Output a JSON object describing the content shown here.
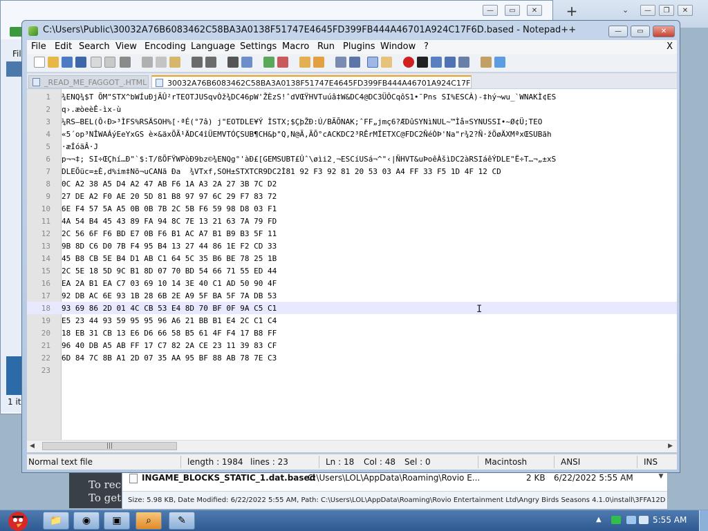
{
  "background": {
    "left_menu_label": "Fil",
    "items_count": "1 ite",
    "partial_text_1": "To reco",
    "partial_text_2": "To get t",
    "search_result": {
      "name": "INGAME_BLOCKS_STATIC_1.dat.based",
      "path": "C:\\Users\\LOL\\AppData\\Roaming\\Rovio E...",
      "size": "2 KB",
      "date": "6/22/2022 5:55 AM"
    },
    "status_text": "Size: 5.98 KB, Date Modified: 6/22/2022 5:55 AM, Path: C:\\Users\\LOL\\AppData\\Roaming\\Rovio Entertainment Ltd\\Angry Birds Seasons 4.1.0\\install\\3FFA12D"
  },
  "window": {
    "title": "C:\\Users\\Public\\30032A76B6083462C58BA3A0138F51747E4645FD399FB444A46701A924C17F6D.based - Notepad++"
  },
  "menu": [
    "File",
    "Edit",
    "Search",
    "View",
    "Encoding",
    "Language",
    "Settings",
    "Macro",
    "Run",
    "Plugins",
    "Window",
    "?"
  ],
  "menu_close": "X",
  "tabs": [
    {
      "label": "_READ_ME_FAGGOT_.HTML",
      "active": false
    },
    {
      "label": "30032A76B6083462C58BA3A0138F51747E4645FD399FB444A46701A924C17F6D.based",
      "active": true
    }
  ],
  "editor": {
    "current_line": 18,
    "lines": [
      {
        "n": "1",
        "text": "¾ENQ¾$T ÕM\"STX^bWÍuÐjÃÛ²rTEOTJUSqvÒž¾DC46pW'ŽÈzS!ˆdVŒŸHVTuúâ‡W&DC4@DC3ÜÔCqôS1•¯Pns SI%ESCÀ)-‡hý¬wu_`WNAKÌ¢ES"
      },
      {
        "n": "2",
        "text": "q›.æòeèÊ-ìx-ù"
      },
      {
        "n": "3",
        "text": "¼RS—BEL(Ô‹Ð>³ÌFS%RSÄSOH%[·ªÉ(°7â) j\"EOTDLE¥Ý ÌSTX;$ÇþŽÐ:Ú/BÃÕNAK;ˆFF„jmç6?ÆDûSYNìNUL~™Ìå¤SYNUSSI•~Ø¢Ü;TEO"
      },
      {
        "n": "4",
        "text": "«5´op³NÎWAÁýEeYxGS è×&äxÕÃ¹ÄDC4îÜEMVTÓÇSUB¶CH&þ\"Q,N@Ã,ÃÕ°cACKDC2³RÊrMÏETXC@FDC2ÑéÒÞ'Na\"r¾2?Ñ·žÖøÄXMªxŒSUBãh"
      },
      {
        "n": "5",
        "text": "·æÍóäÂ·J"
      },
      {
        "n": "6",
        "text": "p¬¬‡; SI÷ŒÇhí…Ð\"`$:T/ßÕFŸWPòÐ9bz©¾ENQg°'àÐ£[GEMSUBT£Ûˆ\\øìi2¸¬ESCíUSá¬^\"‹|ÑHVT&uÞoêÀšìDC2àRSIáêÝDLE\"Ë÷T…¬„±xS"
      },
      {
        "n": "7",
        "text": "DLEÕüc=±È‚d%im‡Nõ¬uCANã Ða  ¾VTxf,SOH±STXTCR9DC2Ì81 92 F3 92 81 20 53 03 A4 FF 33 F5 1D 4F 12 CD"
      },
      {
        "n": "8",
        "text": "0C A2 38 A5 D4 A2 47 AB F6 1A A3 2A 27 3B 7C D2"
      },
      {
        "n": "9",
        "text": "27 DE A2 F0 AE 20 5D 81 B8 97 97 6C 29 F7 83 72"
      },
      {
        "n": "10",
        "text": "6E F4 57 5A A5 0B 0B 7B 2C 5B F6 59 98 D8 03 F1"
      },
      {
        "n": "11",
        "text": "4A 54 B4 45 43 89 FA 94 8C 7E 13 21 63 7A 79 FD"
      },
      {
        "n": "12",
        "text": "2C 56 6F F6 BD E7 0B F6 B1 AC A7 B1 B9 B3 5F 11"
      },
      {
        "n": "13",
        "text": "9B 8D C6 D0 7B F4 95 B4 13 27 44 86 1E F2 CD 33"
      },
      {
        "n": "14",
        "text": "45 B8 CB 5E B4 D1 AB C1 64 5C 35 B6 BE 78 25 1B"
      },
      {
        "n": "15",
        "text": "2C 5E 18 5D 9C B1 8D 07 70 BD 54 66 71 55 ED 44"
      },
      {
        "n": "16",
        "text": "EA 2A B1 EA C7 03 69 10 14 3E 40 C1 AD 50 90 4F"
      },
      {
        "n": "17",
        "text": "92 DB AC 6E 93 1B 28 6B 2E A9 5F BA 5F 7A DB 53"
      },
      {
        "n": "18",
        "text": "93 69 86 2D 01 4C CB 53 E4 8D 70 BF 0F 9A C5 C1"
      },
      {
        "n": "19",
        "text": "E5 23 44 93 59 95 95 96 A6 21 BB B1 E4 2C C1 C4"
      },
      {
        "n": "20",
        "text": "18 EB 31 CB 13 E6 D6 66 58 B5 61 4F F4 17 B8 FF"
      },
      {
        "n": "21",
        "text": "96 40 DB A5 AB FF 17 C7 82 2A CE 23 11 39 83 CF"
      },
      {
        "n": "22",
        "text": "6D 84 7C 8B A1 2D 07 35 AA 95 BF 88 AB 78 7E C3"
      },
      {
        "n": "23",
        "text": ""
      }
    ]
  },
  "status": {
    "file_type": "Normal text file",
    "length": "length : 1984",
    "lines": "lines : 23",
    "ln": "Ln : 18",
    "col": "Col : 48",
    "sel": "Sel : 0",
    "eol": "Macintosh",
    "encoding": "ANSI",
    "mode": "INS"
  },
  "taskbar": {
    "clock": "5:55 AM"
  },
  "colors": {
    "accent_tab": "#f0a020",
    "current_line": "#e8e8ff",
    "taskbar": "#2f5a92"
  }
}
